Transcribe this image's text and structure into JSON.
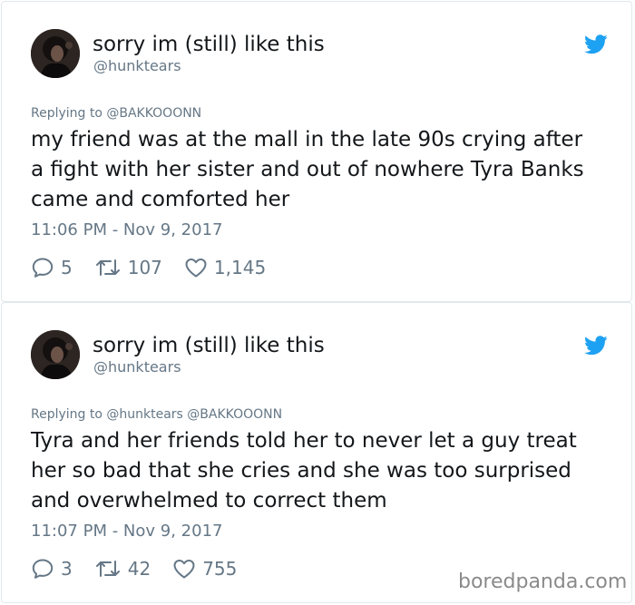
{
  "tweets": [
    {
      "display_name": "sorry im (still) like this",
      "handle": "@hunktears",
      "replying_to": "Replying to @BAKKOOONN",
      "text_lines": [
        "my friend was at the mall in the late 90s crying after",
        "a fight with her sister and out of nowhere Tyra Banks",
        "came and comforted her"
      ],
      "timestamp": "11:06 PM - Nov 9, 2017",
      "replies": "5",
      "retweets": "107",
      "likes": "1,145",
      "icons": {
        "avatar": "avatar",
        "brand": "twitter-bird-icon",
        "reply": "reply-icon",
        "retweet": "retweet-icon",
        "like": "heart-icon"
      }
    },
    {
      "display_name": "sorry im (still) like this",
      "handle": "@hunktears",
      "replying_to": "Replying to @hunktears @BAKKOOONN",
      "text_lines": [
        "Tyra and her friends told her to never let a guy treat",
        "her so bad that she cries and she was too surprised",
        "and overwhelmed to correct them"
      ],
      "timestamp": "11:07 PM - Nov 9, 2017",
      "replies": "3",
      "retweets": "42",
      "likes": "755",
      "icons": {
        "avatar": "avatar",
        "brand": "twitter-bird-icon",
        "reply": "reply-icon",
        "retweet": "retweet-icon",
        "like": "heart-icon"
      }
    }
  ],
  "watermark": "boredpanda.com",
  "colors": {
    "text": "#14171a",
    "secondary": "#657786",
    "brand": "#1da1f2",
    "border": "#e1e8ed"
  }
}
